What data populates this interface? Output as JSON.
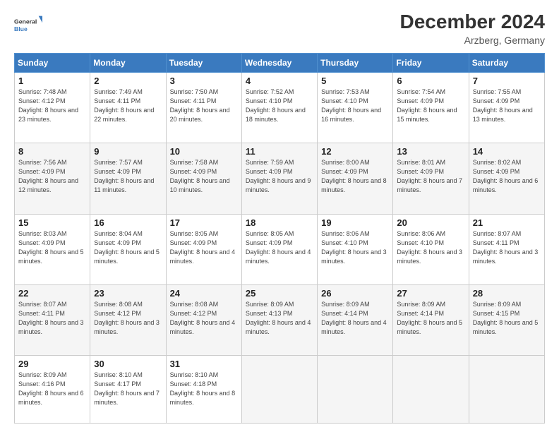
{
  "header": {
    "logo_line1": "General",
    "logo_line2": "Blue",
    "title": "December 2024",
    "subtitle": "Arzberg, Germany"
  },
  "weekdays": [
    "Sunday",
    "Monday",
    "Tuesday",
    "Wednesday",
    "Thursday",
    "Friday",
    "Saturday"
  ],
  "weeks": [
    [
      {
        "day": "1",
        "sunrise": "7:48 AM",
        "sunset": "4:12 PM",
        "daylight": "8 hours and 23 minutes."
      },
      {
        "day": "2",
        "sunrise": "7:49 AM",
        "sunset": "4:11 PM",
        "daylight": "8 hours and 22 minutes."
      },
      {
        "day": "3",
        "sunrise": "7:50 AM",
        "sunset": "4:11 PM",
        "daylight": "8 hours and 20 minutes."
      },
      {
        "day": "4",
        "sunrise": "7:52 AM",
        "sunset": "4:10 PM",
        "daylight": "8 hours and 18 minutes."
      },
      {
        "day": "5",
        "sunrise": "7:53 AM",
        "sunset": "4:10 PM",
        "daylight": "8 hours and 16 minutes."
      },
      {
        "day": "6",
        "sunrise": "7:54 AM",
        "sunset": "4:09 PM",
        "daylight": "8 hours and 15 minutes."
      },
      {
        "day": "7",
        "sunrise": "7:55 AM",
        "sunset": "4:09 PM",
        "daylight": "8 hours and 13 minutes."
      }
    ],
    [
      {
        "day": "8",
        "sunrise": "7:56 AM",
        "sunset": "4:09 PM",
        "daylight": "8 hours and 12 minutes."
      },
      {
        "day": "9",
        "sunrise": "7:57 AM",
        "sunset": "4:09 PM",
        "daylight": "8 hours and 11 minutes."
      },
      {
        "day": "10",
        "sunrise": "7:58 AM",
        "sunset": "4:09 PM",
        "daylight": "8 hours and 10 minutes."
      },
      {
        "day": "11",
        "sunrise": "7:59 AM",
        "sunset": "4:09 PM",
        "daylight": "8 hours and 9 minutes."
      },
      {
        "day": "12",
        "sunrise": "8:00 AM",
        "sunset": "4:09 PM",
        "daylight": "8 hours and 8 minutes."
      },
      {
        "day": "13",
        "sunrise": "8:01 AM",
        "sunset": "4:09 PM",
        "daylight": "8 hours and 7 minutes."
      },
      {
        "day": "14",
        "sunrise": "8:02 AM",
        "sunset": "4:09 PM",
        "daylight": "8 hours and 6 minutes."
      }
    ],
    [
      {
        "day": "15",
        "sunrise": "8:03 AM",
        "sunset": "4:09 PM",
        "daylight": "8 hours and 5 minutes."
      },
      {
        "day": "16",
        "sunrise": "8:04 AM",
        "sunset": "4:09 PM",
        "daylight": "8 hours and 5 minutes."
      },
      {
        "day": "17",
        "sunrise": "8:05 AM",
        "sunset": "4:09 PM",
        "daylight": "8 hours and 4 minutes."
      },
      {
        "day": "18",
        "sunrise": "8:05 AM",
        "sunset": "4:09 PM",
        "daylight": "8 hours and 4 minutes."
      },
      {
        "day": "19",
        "sunrise": "8:06 AM",
        "sunset": "4:10 PM",
        "daylight": "8 hours and 3 minutes."
      },
      {
        "day": "20",
        "sunrise": "8:06 AM",
        "sunset": "4:10 PM",
        "daylight": "8 hours and 3 minutes."
      },
      {
        "day": "21",
        "sunrise": "8:07 AM",
        "sunset": "4:11 PM",
        "daylight": "8 hours and 3 minutes."
      }
    ],
    [
      {
        "day": "22",
        "sunrise": "8:07 AM",
        "sunset": "4:11 PM",
        "daylight": "8 hours and 3 minutes."
      },
      {
        "day": "23",
        "sunrise": "8:08 AM",
        "sunset": "4:12 PM",
        "daylight": "8 hours and 3 minutes."
      },
      {
        "day": "24",
        "sunrise": "8:08 AM",
        "sunset": "4:12 PM",
        "daylight": "8 hours and 4 minutes."
      },
      {
        "day": "25",
        "sunrise": "8:09 AM",
        "sunset": "4:13 PM",
        "daylight": "8 hours and 4 minutes."
      },
      {
        "day": "26",
        "sunrise": "8:09 AM",
        "sunset": "4:14 PM",
        "daylight": "8 hours and 4 minutes."
      },
      {
        "day": "27",
        "sunrise": "8:09 AM",
        "sunset": "4:14 PM",
        "daylight": "8 hours and 5 minutes."
      },
      {
        "day": "28",
        "sunrise": "8:09 AM",
        "sunset": "4:15 PM",
        "daylight": "8 hours and 5 minutes."
      }
    ],
    [
      {
        "day": "29",
        "sunrise": "8:09 AM",
        "sunset": "4:16 PM",
        "daylight": "8 hours and 6 minutes."
      },
      {
        "day": "30",
        "sunrise": "8:10 AM",
        "sunset": "4:17 PM",
        "daylight": "8 hours and 7 minutes."
      },
      {
        "day": "31",
        "sunrise": "8:10 AM",
        "sunset": "4:18 PM",
        "daylight": "8 hours and 8 minutes."
      },
      null,
      null,
      null,
      null
    ]
  ],
  "labels": {
    "sunrise_prefix": "Sunrise: ",
    "sunset_prefix": "Sunset: ",
    "daylight_prefix": "Daylight: "
  }
}
